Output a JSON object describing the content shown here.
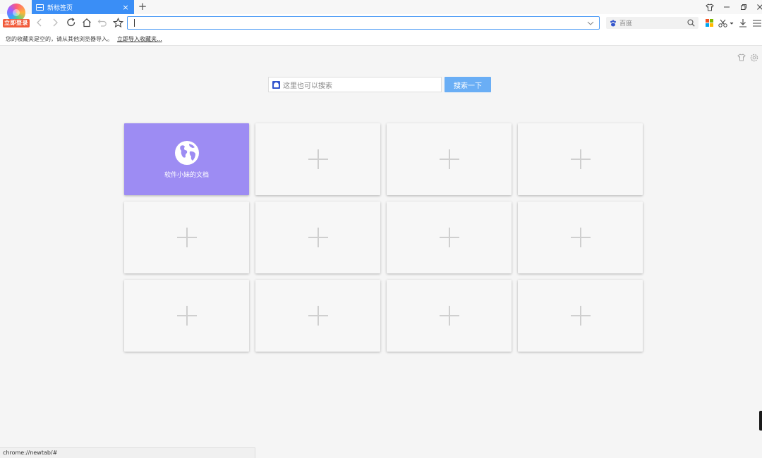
{
  "profile": {
    "login_label": "立即登录"
  },
  "tab": {
    "title": "新标签页",
    "close": "×"
  },
  "newtab": {
    "label": "+"
  },
  "address": {
    "value": ""
  },
  "search_engine": {
    "name": "百度"
  },
  "bookmarks": {
    "empty_text": "您的收藏夹是空的，请从其他浏览器导入。",
    "import_link": "立即导入收藏夹..."
  },
  "main_search": {
    "placeholder": "这里也可以搜索",
    "button": "搜索一下"
  },
  "tiles": [
    {
      "label": "软件小妹的文档",
      "filled": true,
      "color": "#9d8cf3"
    },
    {
      "filled": false
    },
    {
      "filled": false
    },
    {
      "filled": false
    },
    {
      "filled": false
    },
    {
      "filled": false
    },
    {
      "filled": false
    },
    {
      "filled": false
    },
    {
      "filled": false
    },
    {
      "filled": false
    },
    {
      "filled": false
    },
    {
      "filled": false
    }
  ],
  "status": {
    "url": "chrome://newtab/#"
  },
  "colors": {
    "accent": "#3a8ef6",
    "tile_filled": "#9d8cf3",
    "search_button": "#6aaef5"
  }
}
